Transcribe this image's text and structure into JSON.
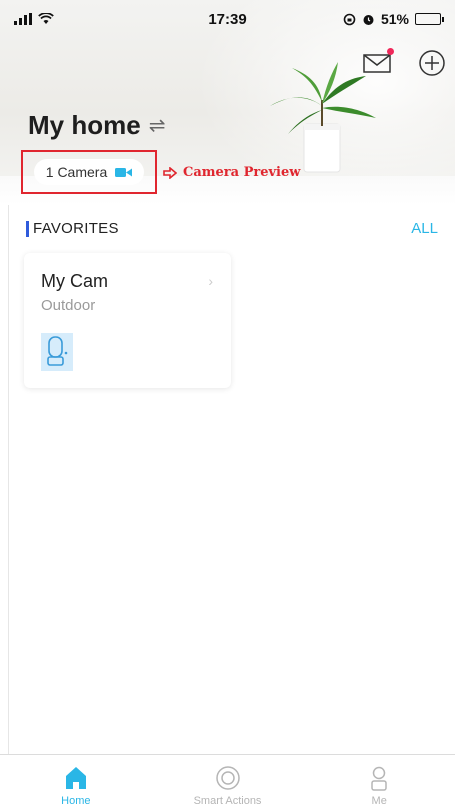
{
  "status_bar": {
    "time": "17:39",
    "battery_percent_label": "51%",
    "battery_level": 0.51,
    "icons": [
      "signal-icon",
      "wifi-icon",
      "lock-rotation-icon",
      "alarm-icon",
      "battery-icon"
    ]
  },
  "header": {
    "title": "My home",
    "switch_icon": "swap-icon",
    "mail_icon": "mail-icon",
    "add_icon": "add-circle-icon",
    "notification_color": "#f0285a"
  },
  "camera_chip": {
    "label": "1 Camera",
    "icon": "video-camera-icon",
    "icon_color": "#2ab6e6"
  },
  "annotation": {
    "text": "Camera Preview",
    "color": "#e0262f"
  },
  "favorites": {
    "title": "FAVORITES",
    "all_label": "ALL",
    "accent_color": "#2f5bdb",
    "link_color": "#2ab6e6",
    "devices": [
      {
        "name": "My Cam",
        "location": "Outdoor",
        "icon": "outdoor-camera-icon"
      }
    ]
  },
  "tabbar": {
    "tabs": [
      {
        "label": "Home",
        "icon": "home-icon",
        "active": true
      },
      {
        "label": "Smart Actions",
        "icon": "smart-actions-icon",
        "active": false
      },
      {
        "label": "Me",
        "icon": "person-icon",
        "active": false
      }
    ]
  }
}
